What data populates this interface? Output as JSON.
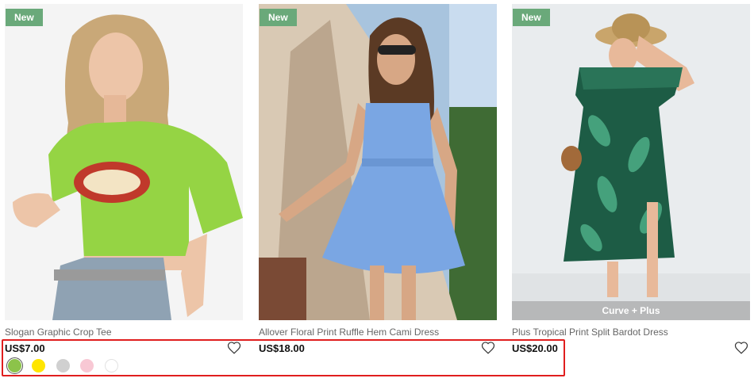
{
  "products": [
    {
      "badge": "New",
      "title": "Slogan Graphic Crop Tee",
      "price": "US$7.00",
      "swatches": [
        "#8cc34a",
        "#ffe500",
        "#d0d0d0",
        "#f8c8d4",
        "#ffffff"
      ]
    },
    {
      "badge": "New",
      "title": "Allover Floral Print Ruffle Hem Cami Dress",
      "price": "US$18.00"
    },
    {
      "badge": "New",
      "title": "Plus Tropical Print Split Bardot Dress",
      "price": "US$20.00",
      "overlay_tag": "Curve + Plus"
    }
  ],
  "colors": {
    "badge_bg": "#6aa97a",
    "highlight_border": "#e01e1e"
  }
}
